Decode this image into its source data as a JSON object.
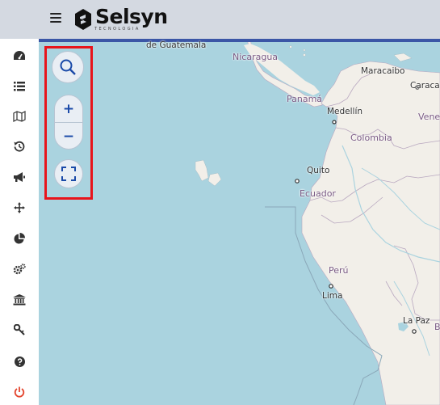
{
  "app": {
    "brand": "Selsyn",
    "brand_sub": "TECNOLOGIA"
  },
  "sidebar": {
    "items": [
      {
        "icon": "dashboard-gauge-icon"
      },
      {
        "icon": "list-icon"
      },
      {
        "icon": "map-icon"
      },
      {
        "icon": "history-icon"
      },
      {
        "icon": "megaphone-icon"
      },
      {
        "icon": "crosshair-icon"
      },
      {
        "icon": "pie-chart-icon"
      },
      {
        "icon": "cogs-icon"
      },
      {
        "icon": "bank-icon"
      },
      {
        "icon": "key-icon"
      },
      {
        "icon": "help-icon"
      },
      {
        "icon": "power-icon"
      }
    ]
  },
  "map_controls": {
    "zoom_in": "+",
    "zoom_out": "−",
    "search_icon": "search-icon",
    "fullscreen_icon": "fullscreen-icon"
  },
  "map": {
    "labels": {
      "guatemala": "de Guatemala",
      "nicaragua": "Nicaragua",
      "maracaibo": "Maracaibo",
      "caracas": "Caracas",
      "panama": "Panamá",
      "medellin": "Medellín",
      "venezuela": "Venez",
      "colombia": "Colombia",
      "quito": "Quito",
      "ecuador": "Ecuador",
      "peru": "Perú",
      "lima": "Lima",
      "la_paz": "La Paz",
      "bolivia_abbr": "B"
    },
    "colors": {
      "water": "#aad3df",
      "land": "#f2efe9",
      "country_label": "#7a5a84",
      "highlight": "#e8141b",
      "accent": "#1a4aa8"
    }
  }
}
